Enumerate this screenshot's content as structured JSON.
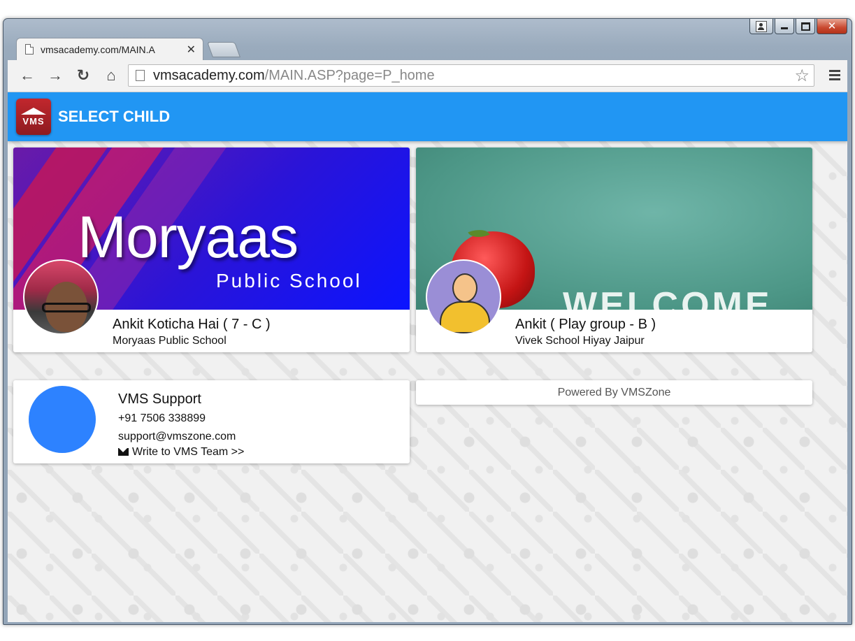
{
  "browser": {
    "tab_title": "vmsacademy.com/MAIN.A",
    "url_host": "vmsacademy.com",
    "url_path": "/MAIN.ASP?page=P_home"
  },
  "app": {
    "title": "SELECT CHILD",
    "logo_text": "VMS",
    "accent_color": "#2196f3"
  },
  "children": [
    {
      "name": "Ankit Koticha Hai ( 7 - C )",
      "school": "Moryaas Public School",
      "banner_title": "Moryaas",
      "banner_subtitle": "Public School"
    },
    {
      "name": "Ankit ( Play group - B )",
      "school": "Vivek School Hiyay Jaipur",
      "banner_text": "WELCOME"
    }
  ],
  "support": {
    "title": "VMS Support",
    "phone": "+91 7506 338899",
    "email": "support@vmszone.com",
    "write_link": "Write to VMS Team >>"
  },
  "footer": {
    "powered_by": "Powered By VMSZone"
  }
}
